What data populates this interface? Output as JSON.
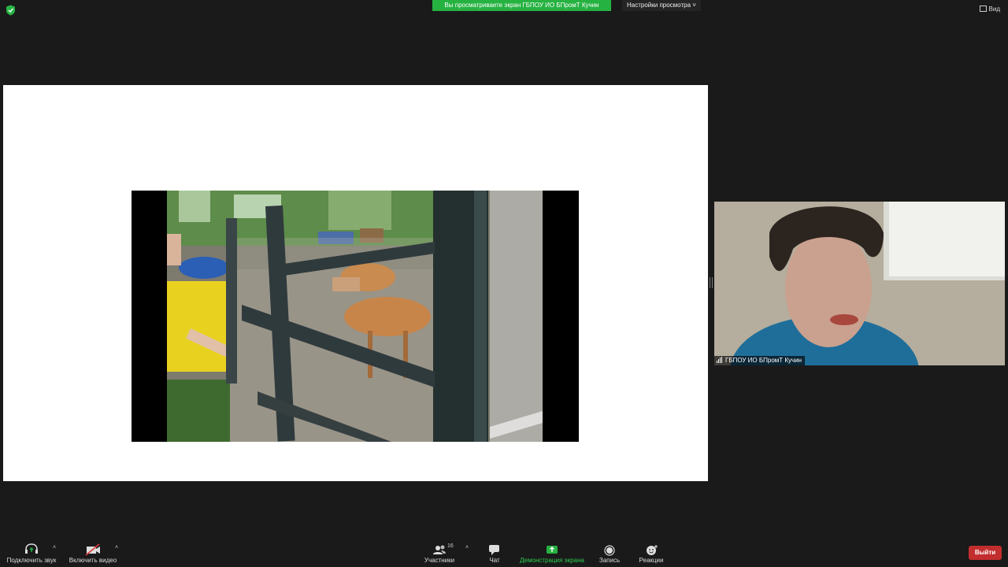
{
  "top": {
    "banner_text": "Вы просматриваете экран ГБПОУ ИО БПромТ Кучин",
    "view_options": "Настройки просмотра",
    "view_button": "Вид"
  },
  "video": {
    "name": "ГБПОУ ИО БПромТ Кучин"
  },
  "toolbar": {
    "audio": "Подключить звук",
    "video": "Включить видео",
    "participants": "Участники",
    "participants_count": "16",
    "chat": "Чат",
    "share": "Демонстрация экрана",
    "record": "Запись",
    "reactions": "Реакции",
    "leave": "Выйти"
  },
  "colors": {
    "share_green": "#26b241",
    "leave_red": "#c22d2d",
    "background": "#1a1a1a"
  }
}
